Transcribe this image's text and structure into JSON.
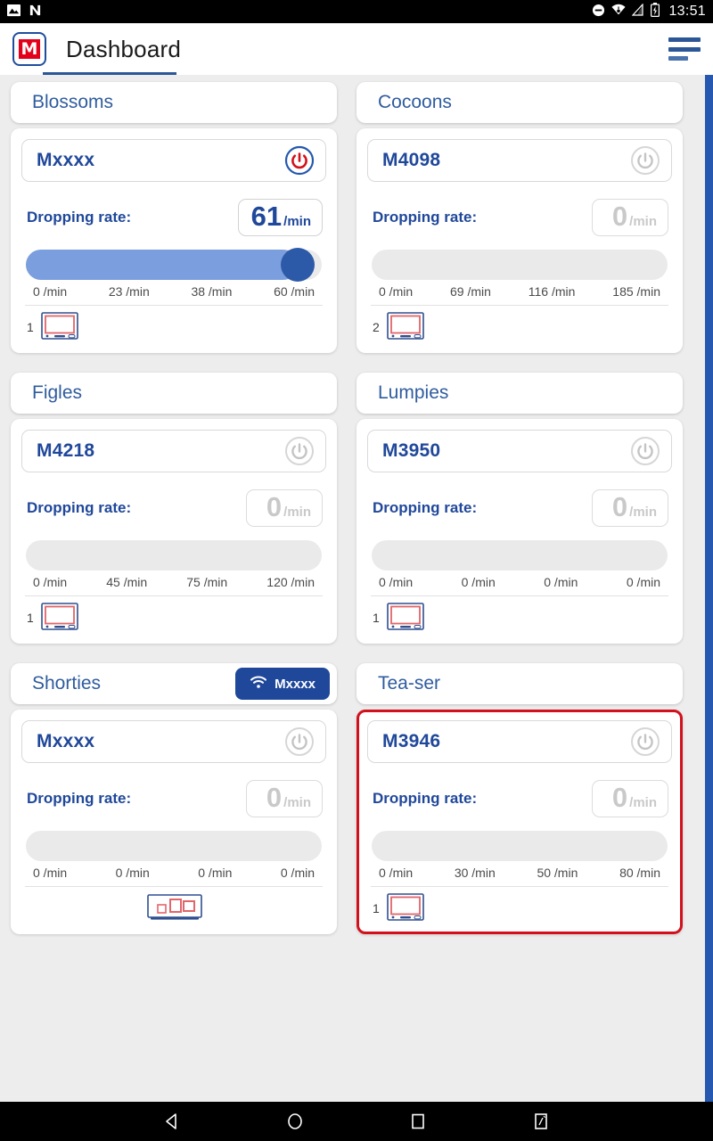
{
  "status_bar": {
    "icons_left": [
      "image-icon",
      "nextcloud-n-icon"
    ],
    "icons_right": [
      "do-not-disturb-icon",
      "wifi-icon",
      "cellular-signal-icon",
      "battery-icon"
    ],
    "time": "13:51"
  },
  "app_bar": {
    "logo_letter": "M",
    "title": "Dashboard",
    "menu_icon": "hamburger-menu-icon"
  },
  "colors": {
    "brand_blue": "#20489a",
    "accent_blue": "#2f5c9e",
    "logo_red": "#e3001b",
    "alert_red": "#d2111d",
    "slider_fill": "#7b9ede",
    "slider_knob": "#2d5aa8",
    "background": "#ededed",
    "disabled_gray": "#c9c9c9"
  },
  "labels": {
    "dropping_rate": "Dropping rate:",
    "rate_unit": "/min"
  },
  "groups": [
    {
      "title": "Blossoms",
      "badge": null,
      "machine": {
        "name": "Mxxxx",
        "power_state": "on",
        "power_icon": "power-icon",
        "rate_value": "61",
        "rate_unit": "/min",
        "rate_active": true,
        "slider_percent": 92,
        "ticks": [
          "0 /min",
          "23 /min",
          "38 /min",
          "60 /min"
        ],
        "device_count": "1",
        "device_icon": "machine-device-icon",
        "alert": false
      }
    },
    {
      "title": "Cocoons",
      "badge": null,
      "machine": {
        "name": "M4098",
        "power_state": "off",
        "power_icon": "power-icon",
        "rate_value": "0",
        "rate_unit": "/min",
        "rate_active": false,
        "slider_percent": 0,
        "ticks": [
          "0 /min",
          "69 /min",
          "116 /min",
          "185 /min"
        ],
        "device_count": "2",
        "device_icon": "machine-device-icon",
        "alert": false
      }
    },
    {
      "title": "Figles",
      "badge": null,
      "machine": {
        "name": "M4218",
        "power_state": "off",
        "power_icon": "power-icon",
        "rate_value": "0",
        "rate_unit": "/min",
        "rate_active": false,
        "slider_percent": 0,
        "ticks": [
          "0 /min",
          "45 /min",
          "75 /min",
          "120 /min"
        ],
        "device_count": "1",
        "device_icon": "machine-device-icon",
        "alert": false
      }
    },
    {
      "title": "Lumpies",
      "badge": null,
      "machine": {
        "name": "M3950",
        "power_state": "off",
        "power_icon": "power-icon",
        "rate_value": "0",
        "rate_unit": "/min",
        "rate_active": false,
        "slider_percent": 0,
        "ticks": [
          "0 /min",
          "0 /min",
          "0 /min",
          "0 /min"
        ],
        "device_count": "1",
        "device_icon": "machine-device-icon",
        "alert": false
      }
    },
    {
      "title": "Shorties",
      "badge": {
        "label": "Mxxxx",
        "icon": "wifi-icon"
      },
      "machine": {
        "name": "Mxxxx",
        "power_state": "off",
        "power_icon": "power-icon",
        "rate_value": "0",
        "rate_unit": "/min",
        "rate_active": false,
        "slider_percent": 0,
        "ticks": [
          "0 /min",
          "0 /min",
          "0 /min",
          "0 /min"
        ],
        "device_count": "",
        "device_icon": "multi-station-device-icon",
        "alert": false
      }
    },
    {
      "title": "Tea-ser",
      "badge": null,
      "machine": {
        "name": "M3946",
        "power_state": "off",
        "power_icon": "power-icon",
        "rate_value": "0",
        "rate_unit": "/min",
        "rate_active": false,
        "slider_percent": 0,
        "ticks": [
          "0 /min",
          "30 /min",
          "50 /min",
          "80 /min"
        ],
        "device_count": "1",
        "device_icon": "machine-device-icon",
        "alert": true
      }
    }
  ],
  "nav_bar": {
    "buttons": [
      "back-icon",
      "home-icon",
      "recents-icon",
      "screenshot-icon"
    ]
  }
}
